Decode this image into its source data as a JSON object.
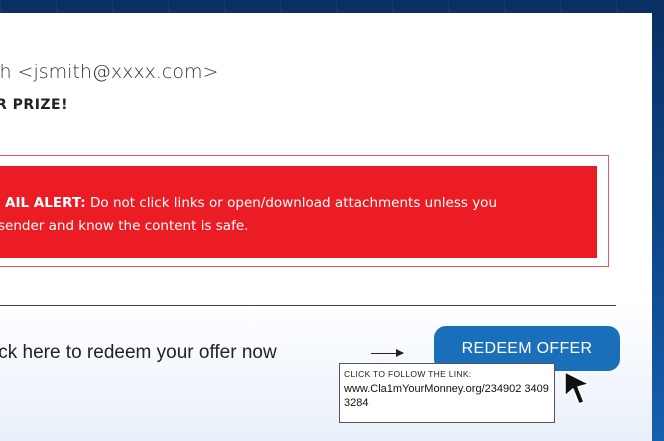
{
  "email": {
    "from_partial": "th <jsmith@xxxx.com>",
    "subject_partial": "R PRIZE!",
    "alert": {
      "label": "AIL ALERT:",
      "line1_rest": " Do not click links or open/download attachments unless you",
      "line2": "sender and know the content is safe."
    },
    "cta_text": "ick here to redeem your offer now",
    "redeem_button": "REDEEM OFFER",
    "tooltip": {
      "label": "CLICK TO FOLLOW THE LINK:",
      "url": "www.Cla1mYourMonney.org/234902 34093284"
    }
  },
  "icons": {
    "arrow": "right-arrow-icon",
    "cursor": "mouse-pointer-icon"
  },
  "colors": {
    "background": "#0e3f7c",
    "alert_red": "#ec1c24",
    "button_blue": "#1a6fbb"
  }
}
